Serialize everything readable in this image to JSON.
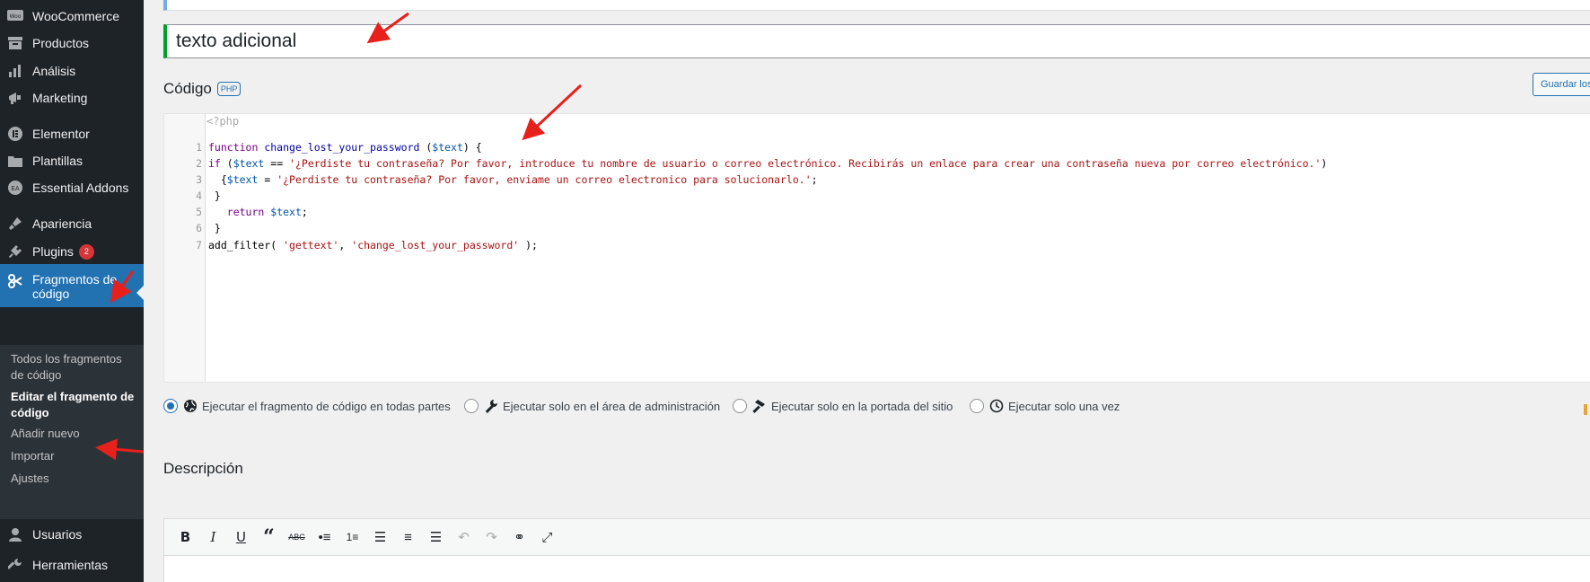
{
  "sidebar": {
    "items": [
      {
        "label": "WooCommerce",
        "icon": "woo-icon"
      },
      {
        "label": "Productos",
        "icon": "archive-icon"
      },
      {
        "label": "Análisis",
        "icon": "bar-chart-icon"
      },
      {
        "label": "Marketing",
        "icon": "megaphone-icon"
      },
      {
        "label": "Elementor",
        "icon": "elementor-icon"
      },
      {
        "label": "Plantillas",
        "icon": "folder-icon"
      },
      {
        "label": "Essential Addons",
        "icon": "ea-icon"
      },
      {
        "label": "Apariencia",
        "icon": "brush-icon"
      },
      {
        "label": "Plugins",
        "icon": "plugin-icon",
        "badge": "2"
      },
      {
        "label": "Fragmentos de código",
        "icon": "scissors-icon"
      },
      {
        "label": "Usuarios",
        "icon": "user-icon"
      },
      {
        "label": "Herramientas",
        "icon": "wrench-icon"
      }
    ],
    "submenu": [
      {
        "label": "Todos los fragmentos de código"
      },
      {
        "label": "Editar el fragmento de código"
      },
      {
        "label": "Añadir nuevo"
      },
      {
        "label": "Importar"
      },
      {
        "label": "Ajustes"
      }
    ]
  },
  "snippet": {
    "title": "texto adicional",
    "code_heading": "Código",
    "language_tag": "PHP",
    "save_label": "Guardar los",
    "php_open": "<?php"
  },
  "code_lines": [
    {
      "n": "1",
      "text": "function change_lost_your_password ($text) {"
    },
    {
      "n": "2",
      "text": "if ($text == '¿Perdiste tu contraseña? Por favor, introduce tu nombre de usuario o correo electrónico. Recibirás un enlace para crear una contraseña nueva por correo electrónico.')"
    },
    {
      "n": "3",
      "text": "  {$text = '¿Perdiste tu contraseña? Por favor, enviame un correo electronico para solucionarlo.';"
    },
    {
      "n": "4",
      "text": " }"
    },
    {
      "n": "5",
      "text": "   return $text;"
    },
    {
      "n": "6",
      "text": " }"
    },
    {
      "n": "7",
      "text": "add_filter( 'gettext', 'change_lost_your_password' );"
    }
  ],
  "scope": {
    "selected": "everywhere",
    "options": [
      {
        "id": "everywhere",
        "label": "Ejecutar el fragmento de código en todas partes",
        "icon": "globe-icon"
      },
      {
        "id": "admin",
        "label": "Ejecutar solo en el área de administración",
        "icon": "wrench-icon"
      },
      {
        "id": "front",
        "label": "Ejecutar solo en la portada del sitio",
        "icon": "hammer-icon"
      },
      {
        "id": "once",
        "label": "Ejecutar solo una vez",
        "icon": "clock-icon"
      }
    ]
  },
  "description": {
    "heading": "Descripción",
    "toolbar": [
      "bold-icon",
      "italic-icon",
      "underline-icon",
      "blockquote-icon",
      "strikethrough-icon",
      "bullet-list-icon",
      "numbered-list-icon",
      "align-left-icon",
      "align-center-icon",
      "align-right-icon",
      "undo-icon",
      "redo-icon",
      "link-icon",
      "fullscreen-icon"
    ]
  },
  "colors": {
    "sidebar_bg": "#1d2327",
    "active_bg": "#2271b1",
    "accent": "#2271b1",
    "annotation": "#e8201b"
  }
}
